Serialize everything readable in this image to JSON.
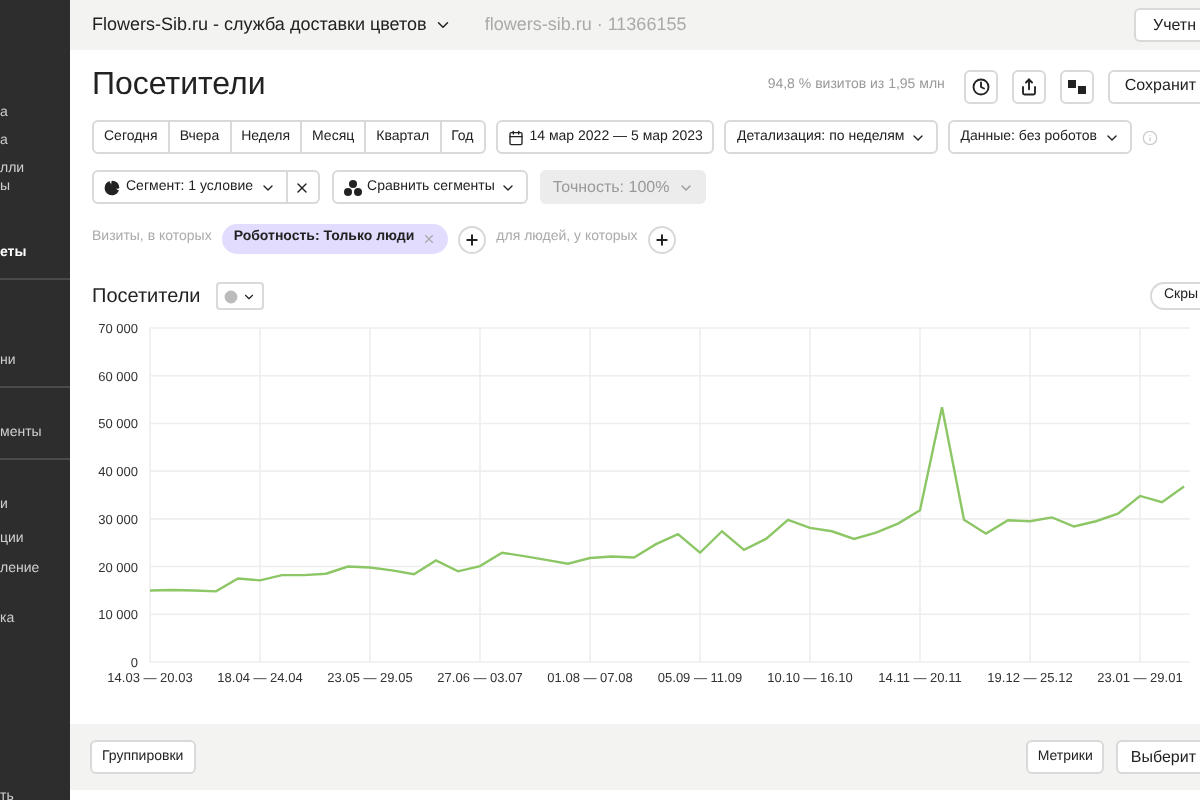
{
  "sidebar": {
    "items": [
      {
        "label": "а",
        "selected": false,
        "divider": false
      },
      {
        "label": "а",
        "selected": false,
        "divider": false
      },
      {
        "label": "лли",
        "selected": false,
        "divider": false
      },
      {
        "label": "ы",
        "selected": false,
        "divider": false
      },
      {
        "label": "еты",
        "selected": true,
        "divider": true
      },
      {
        "label": "ни",
        "selected": false,
        "divider": true
      },
      {
        "label": "менты",
        "selected": false,
        "divider": true
      },
      {
        "label": "и",
        "selected": false,
        "divider": false
      },
      {
        "label": "ции",
        "selected": false,
        "divider": false
      },
      {
        "label": "ление",
        "selected": false,
        "divider": false
      },
      {
        "label": "ка",
        "selected": false,
        "divider": false
      },
      {
        "label": "ть",
        "selected": false,
        "divider": false
      }
    ]
  },
  "header": {
    "counter_name": "Flowers-Sib.ru - служба доставки цветов",
    "counter_id": "flowers-sib.ru · 11366155",
    "account_button": "Учетн"
  },
  "page_title": "Посетители",
  "sampling": "94,8 % визитов из 1,95 млн",
  "save_button": "Сохранит",
  "periods": [
    {
      "label": "Сегодня",
      "selected": false
    },
    {
      "label": "Вчера",
      "selected": false
    },
    {
      "label": "Неделя",
      "selected": false
    },
    {
      "label": "Месяц",
      "selected": false
    },
    {
      "label": "Квартал",
      "selected": false
    },
    {
      "label": "Год",
      "selected": false
    }
  ],
  "date_range": "14 мар 2022 — 5 мар 2023",
  "detail_dropdown": "Детализация: по неделям",
  "data_dropdown": "Данные: без роботов",
  "segment_dropdown": "Сегмент: 1 условие",
  "compare_dropdown": "Сравнить сегменты",
  "accuracy_dropdown": {
    "label": "Точность: 100%",
    "disabled": true
  },
  "filter": {
    "prefix": "Визиты, в которых",
    "chip": "Роботность: Только люди",
    "people_label": "для людей, у которых"
  },
  "chart_panel": {
    "title": "Посетители",
    "hide_button": "Скры",
    "chart_data": {
      "type": "line",
      "categories": [
        "14.03 — 20.03",
        null,
        null,
        null,
        null,
        "18.04 — 24.04",
        null,
        null,
        null,
        null,
        "23.05 — 29.05",
        null,
        null,
        null,
        null,
        "27.06 — 03.07",
        null,
        null,
        null,
        null,
        "01.08 — 07.08",
        null,
        null,
        null,
        null,
        "05.09 — 11.09",
        null,
        null,
        null,
        null,
        "10.10 — 16.10",
        null,
        null,
        null,
        null,
        "14.11 — 20.11",
        null,
        null,
        null,
        null,
        "19.12 — 25.12",
        null,
        null,
        null,
        null,
        "23.01 — 29.01",
        null,
        null
      ],
      "grid": true,
      "series": [
        {
          "color": "#8cc665",
          "values": [
            15000,
            15100,
            15000,
            14800,
            17500,
            17100,
            18200,
            18200,
            18500,
            20000,
            19800,
            19200,
            18400,
            21300,
            19000,
            20100,
            22900,
            22200,
            21400,
            20600,
            21800,
            22100,
            21900,
            24700,
            26800,
            22900,
            27400,
            23500,
            25800,
            29800,
            28100,
            27400,
            25800,
            27100,
            29000,
            31800,
            53400,
            29800,
            26900,
            29700,
            29500,
            30300,
            28400,
            29500,
            31100,
            34800,
            33500,
            36800
          ]
        }
      ],
      "ylim": [
        0,
        70000
      ],
      "yticks": [
        {
          "value": 70000,
          "label": "70 000"
        },
        {
          "value": 60000,
          "label": "60 000"
        },
        {
          "value": 50000,
          "label": "50 000"
        },
        {
          "value": 40000,
          "label": "40 000"
        },
        {
          "value": 30000,
          "label": "30 000"
        },
        {
          "value": 20000,
          "label": "20 000"
        },
        {
          "value": 10000,
          "label": "10 000"
        },
        {
          "value": 0,
          "label": "0"
        }
      ]
    }
  },
  "bottom_bar": {
    "groupings_button": "Группировки",
    "metrics_button": "Метрики",
    "select_button": "Выберит"
  }
}
